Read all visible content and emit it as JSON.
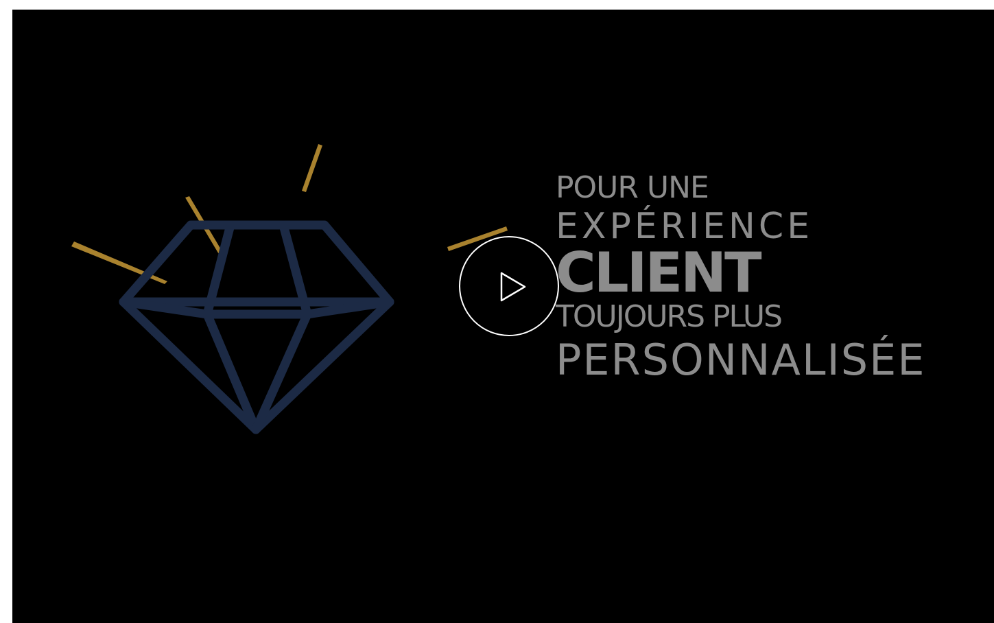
{
  "tagline": {
    "line1": "POUR UNE",
    "line2": "EXPÉRIENCE",
    "line3": "CLIENT",
    "line4": "TOUJOURS PLUS",
    "line5": "PERSONNALISÉE"
  },
  "player": {
    "play_icon": "play-icon"
  },
  "colors": {
    "background": "#000000",
    "text": "#8c8c8c",
    "diamond": "#1c2a45",
    "sparkle": "#a9822e",
    "play": "#ffffff"
  }
}
